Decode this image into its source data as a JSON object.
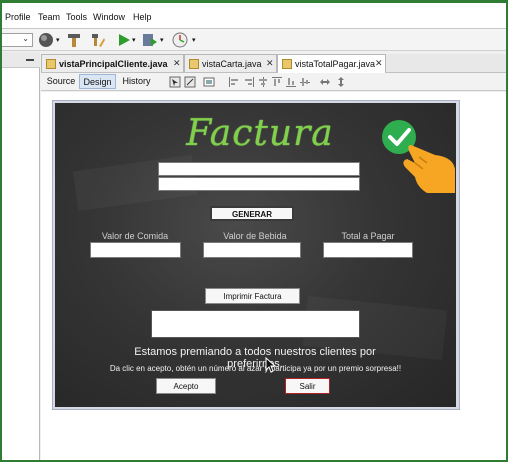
{
  "menu": [
    "Profile",
    "Team",
    "Tools",
    "Window",
    "Help"
  ],
  "toolbar": {
    "icons": [
      "globe-icon",
      "hammer-icon",
      "clean-build-icon",
      "run-icon",
      "debug-icon",
      "profile-icon"
    ]
  },
  "tabs": [
    {
      "label": "vistaPrincipalCliente.java",
      "active": false,
      "close": "✕"
    },
    {
      "label": "vistaCarta.java",
      "active": false,
      "close": "✕"
    },
    {
      "label": "vistaTotalPagar.java",
      "active": true,
      "close": "✕"
    }
  ],
  "view_tabs": {
    "source": "Source",
    "design": "Design",
    "history": "History"
  },
  "form": {
    "title": "Factura",
    "generate_button": "GENERAR",
    "labels": {
      "food": "Valor de Comida",
      "drink": "Valor de Bebida",
      "total": "Total a Pagar"
    },
    "print_button": "Imprimir Factura",
    "promo_line1": "Estamos premiando a todos nuestros clientes por preferirnos.",
    "promo_line2": "Da clic en acepto, obtén un número al azar y participa ya por un premio sorpresa!!",
    "accept_button": "Acepto",
    "exit_button": "Salir"
  },
  "colors": {
    "title_green": "#7fd04a",
    "chalkboard": "#353535",
    "check_green": "#2fae4f",
    "hand_orange": "#f6a623",
    "outer_border": "#2e7d32",
    "exit_button_border": "#b22222"
  }
}
